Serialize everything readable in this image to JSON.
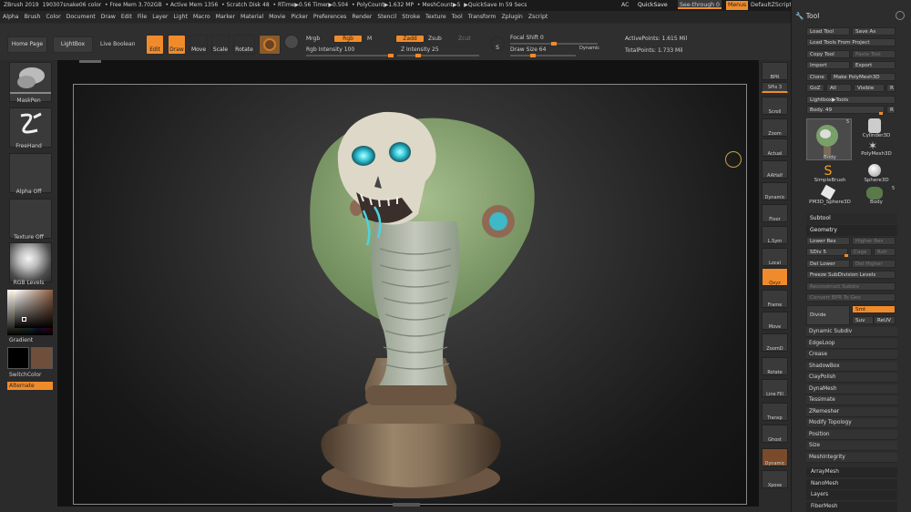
{
  "titlebar": {
    "app": "ZBrush 2019",
    "doc": "190307snake06 color",
    "free_mem": "• Free Mem 3.702GB",
    "active_mem": "• Active Mem 1356",
    "scratch": "• Scratch Disk 48",
    "rtime": "• RTime▶0.56 Timer▶0.504",
    "polycount": "• PolyCount▶1.632 MP",
    "meshcount": "• MeshCount▶5",
    "quicksave_in": "▶QuickSave In 59 Secs"
  },
  "right_header": {
    "ac": "AC",
    "quicksave": "QuickSave",
    "see_through": "See-through 0",
    "menus": "Menus",
    "script": "DefaultZScript"
  },
  "menu": [
    "Alpha",
    "Brush",
    "Color",
    "Document",
    "Draw",
    "Edit",
    "File",
    "Layer",
    "Light",
    "Macro",
    "Marker",
    "Material",
    "Movie",
    "Picker",
    "Preferences",
    "Render",
    "Stencil",
    "Stroke",
    "Texture",
    "Tool",
    "Transform",
    "Zplugin",
    "Zscript"
  ],
  "toolbar": {
    "home": "Home Page",
    "lightbox": "LightBox",
    "live_boolean": "Live Boolean",
    "edit": "Edit",
    "draw": "Draw",
    "move": "Move",
    "scale": "Scale",
    "rotate": "Rotate",
    "mrgb": "Mrgb",
    "rgb": "Rgb",
    "m": "M",
    "rgb_intensity": "Rgb Intensity 100",
    "zadd": "Zadd",
    "zsub": "Zsub",
    "zcut": "Zcut",
    "z_intensity": "Z Intensity 25",
    "focal_shift": "Focal Shift 0",
    "draw_size": "Draw Size 64",
    "dynamic": "Dynamic",
    "active_points": "ActivePoints: 1.615 Mil",
    "total_points": "TotalPoints: 1.733 Mil",
    "s_label": "S"
  },
  "left": {
    "brush": "MaskPen",
    "stroke": "FreeHand",
    "alpha": "Alpha Off",
    "texture": "Texture Off",
    "material": "RGB Levels",
    "gradient": "Gradient",
    "switch": "SwitchColor",
    "alternate": "Alternate"
  },
  "shelf": [
    "BPR",
    "SPix 3",
    "Scroll",
    "Zoom",
    "Actual",
    "AAHalf",
    "Dynamic Persp",
    "Floor",
    "L.Sym",
    "Local",
    "Qxyz",
    "Frame",
    "Move",
    "ZoomD",
    "Rotate",
    "Line Fill PolyF",
    "Transp",
    "Ghost",
    "Dynamic Solo",
    "Xpose"
  ],
  "tool": {
    "title": "Tool",
    "load_tool": "Load Tool",
    "save_as": "Save As",
    "load_from_project": "Load Tools From Project",
    "copy_tool": "Copy Tool",
    "paste_tool": "Paste Tool",
    "import": "Import",
    "export": "Export",
    "clone": "Clone",
    "make_polymesh": "Make PolyMesh3D",
    "goz": "GoZ",
    "all": "All",
    "visible": "Visible",
    "r": "R",
    "lightbox_tools": "Lightbox▶Tools",
    "body": "Body. 49",
    "r2": "R",
    "thumbs": [
      "Body",
      "Cylinder3D",
      "PolyMesh3D",
      "SimpleBrush",
      "Sphere3D",
      "PM3D_Sphere3D",
      "Body"
    ],
    "thumb_count": "5",
    "thumb_count2": "5",
    "subtool": "Subtool",
    "geometry": "Geometry",
    "lower_res": "Lower Res",
    "higher_res": "Higher Res",
    "sdiv": "SDiv 5",
    "cage": "Cage",
    "rstr": "Rstr",
    "del_lower": "Del Lower",
    "del_higher": "Del Higher",
    "freeze": "Freeze SubDivision Levels",
    "reconstruct": "Reconstruct Subdiv",
    "convert_bpr": "Convert BPR To Geo",
    "divide": "Divide",
    "smt": "Smt",
    "suv": "Suv",
    "reuv": "ReUV",
    "geo_items": [
      "Dynamic Subdiv",
      "EdgeLoop",
      "Crease",
      "ShadowBox",
      "ClayPolish",
      "DynaMesh",
      "Tessimate",
      "ZRemesher",
      "Modify Topology",
      "Position",
      "Size",
      "MeshIntegrity"
    ],
    "sections": [
      "ArrayMesh",
      "NanoMesh",
      "Layers",
      "FiberMesh"
    ]
  },
  "colors": {
    "accent": "#f08b2b",
    "panel": "#2d2d2d",
    "bg": "#121212"
  }
}
